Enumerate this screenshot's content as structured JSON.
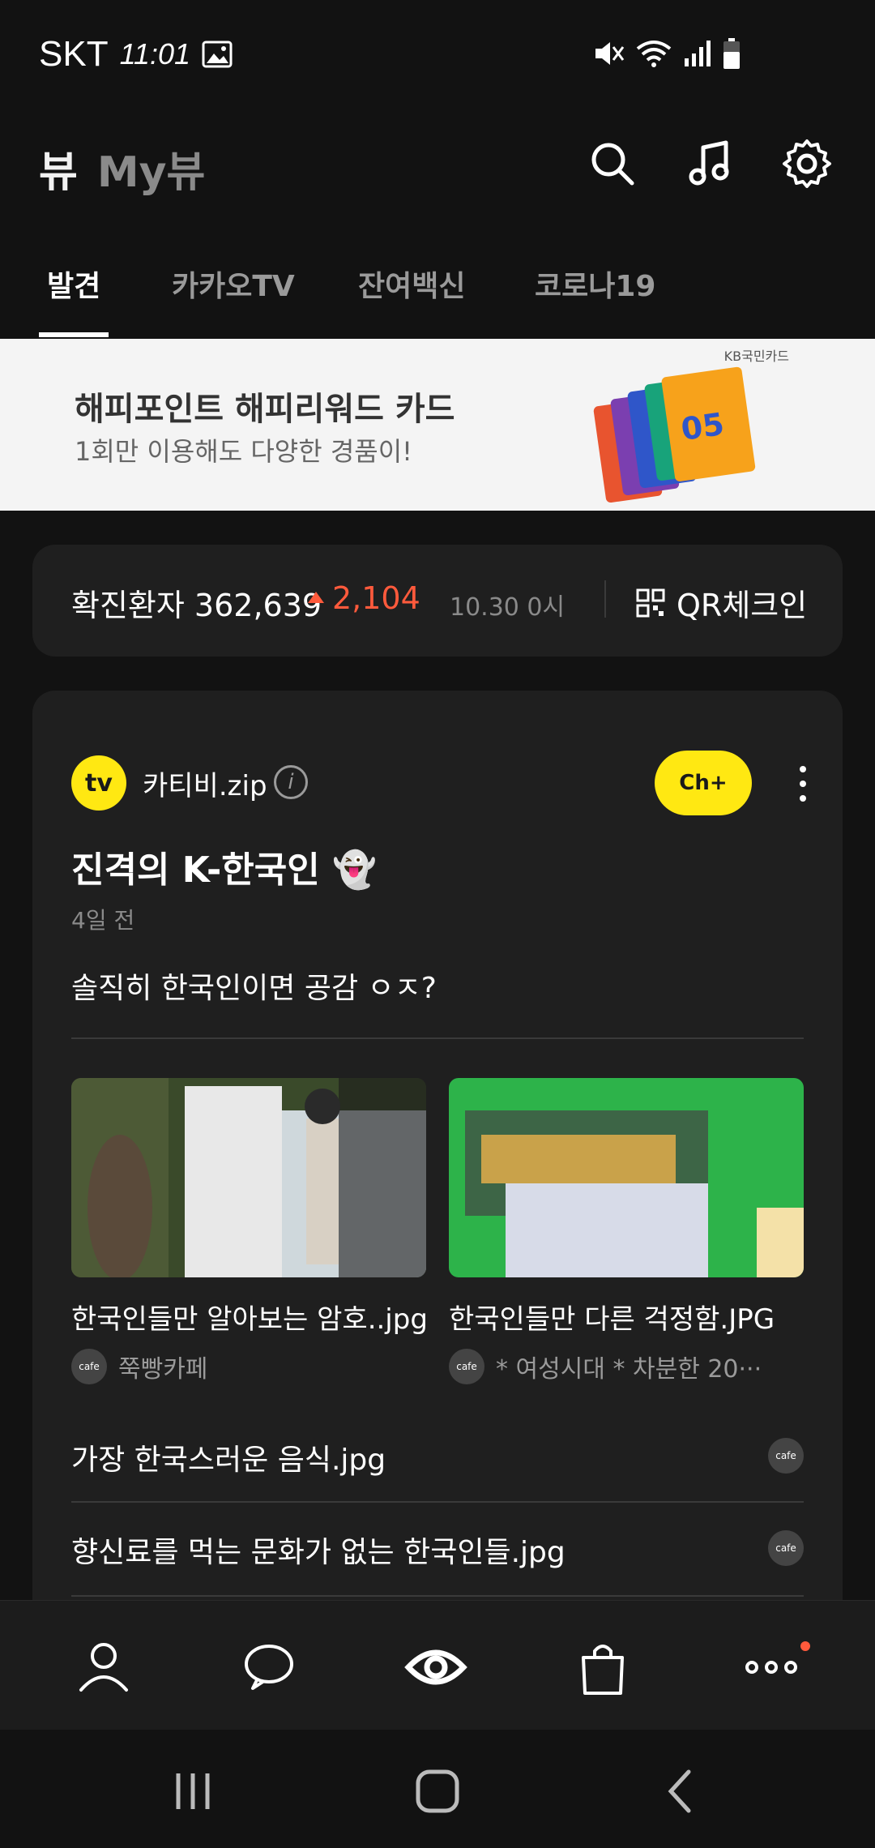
{
  "status_bar": {
    "carrier": "SKT",
    "time": "11:01"
  },
  "header": {
    "brand": "뷰",
    "my": "My뷰"
  },
  "tabs": [
    {
      "label": "발견",
      "active": true
    },
    {
      "label": "카카오TV",
      "active": false
    },
    {
      "label": "잔여백신",
      "active": false
    },
    {
      "label": "코로나19",
      "active": false
    }
  ],
  "ad": {
    "title": "해피포인트 해피리워드 카드",
    "subtitle": "1회만 이용해도 다양한 경품이!",
    "brand": "KB국민카드"
  },
  "covid": {
    "label": "확진환자 362,639",
    "increase": "2,104",
    "date": "10.30 0시",
    "qr_label": "QR체크인"
  },
  "card": {
    "channel_name": "카티비.zip",
    "channel_icon_text": "tv",
    "channel_plus_label": "Ch+",
    "title": "진격의 K-한국인 👻",
    "time": "4일 전",
    "description": "솔직히 한국인이면 공감 ㅇㅈ?",
    "thumbs": [
      {
        "title": "한국인들만 알아보는 암호..jpg",
        "source": "쭉빵카페"
      },
      {
        "title": "한국인들만 다른 걱정함.JPG",
        "source": "* 여성시대 *  차분한 20···"
      }
    ],
    "list": [
      {
        "title": "가장 한국스러운 음식.jpg"
      },
      {
        "title": "향신료를 먹는 문화가 없는 한국인들.jpg"
      }
    ],
    "cafe_badge": "cafe"
  },
  "colors": {
    "accent_red": "#ff5a3c",
    "kakao_yellow": "#ffe812",
    "bg": "#121212",
    "card": "#1f1f1f"
  }
}
